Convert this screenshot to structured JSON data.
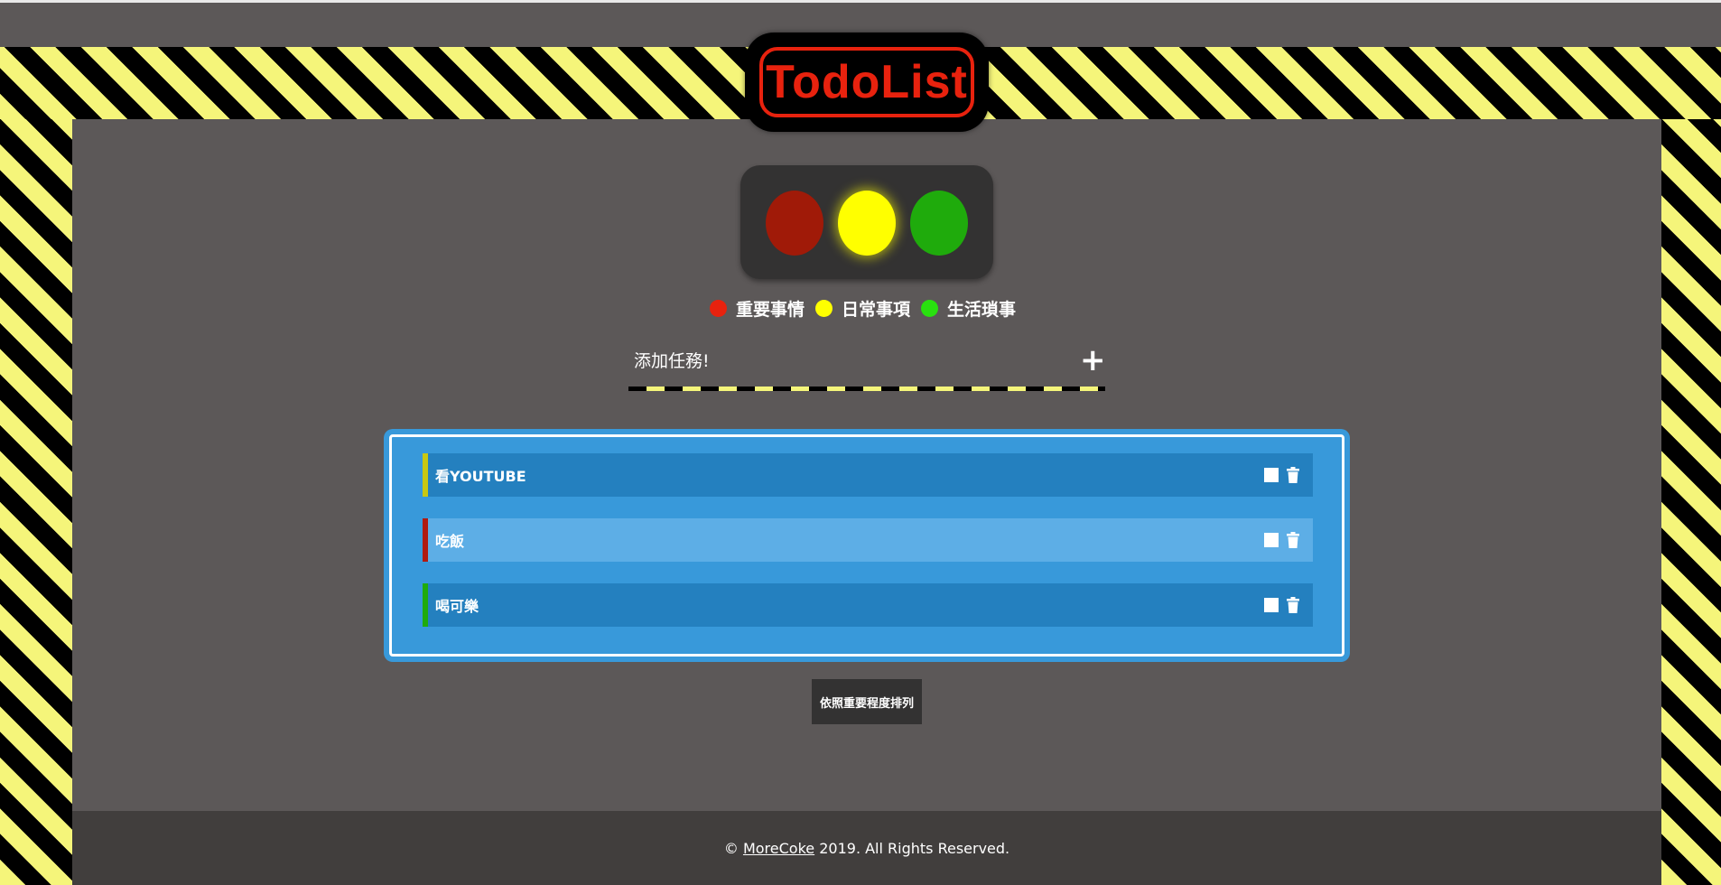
{
  "app": {
    "title": "TodoList"
  },
  "traffic_light": {
    "lamps": [
      {
        "name": "red",
        "color": "#a01a08"
      },
      {
        "name": "yellow",
        "color": "#ffff00",
        "active": true
      },
      {
        "name": "green",
        "color": "#1fab0c"
      }
    ]
  },
  "legend": [
    {
      "label": "重要事情",
      "color": "#e8220e"
    },
    {
      "label": "日常事項",
      "color": "#ffff00"
    },
    {
      "label": "生活瑣事",
      "color": "#29e10f"
    }
  ],
  "add_task": {
    "placeholder": "添加任務!",
    "add_icon": "plus-icon"
  },
  "todos": [
    {
      "text": "看YOUTUBE",
      "priority_color": "#c8c812",
      "row_color": "#2480bf"
    },
    {
      "text": "吃飯",
      "priority_color": "#b01a10",
      "row_color": "#5daee6"
    },
    {
      "text": "喝可樂",
      "priority_color": "#1fab0c",
      "row_color": "#2480bf"
    }
  ],
  "sort_button": {
    "label": "依照重要程度排列"
  },
  "footer": {
    "copyright": "©",
    "link": "MoreCoke",
    "rest": "2019. All Rights Reserved."
  }
}
